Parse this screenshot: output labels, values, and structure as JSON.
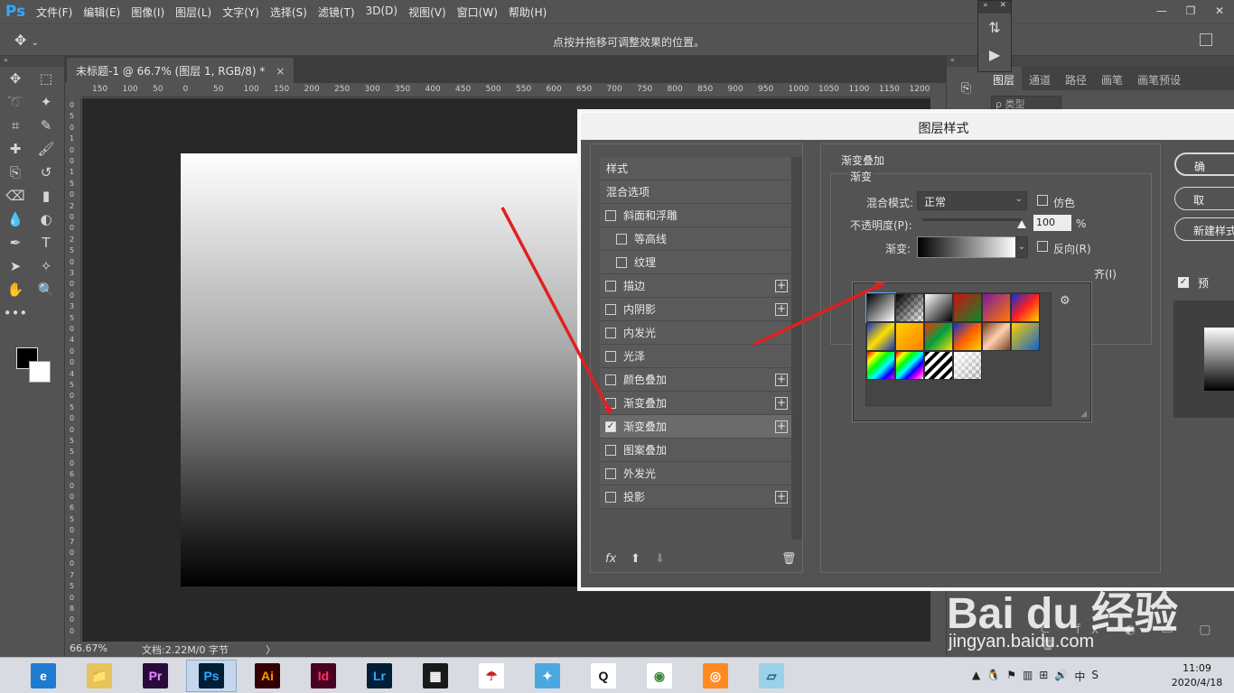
{
  "menubar": {
    "logo": "Ps",
    "items": [
      "文件(F)",
      "编辑(E)",
      "图像(I)",
      "图层(L)",
      "文字(Y)",
      "选择(S)",
      "滤镜(T)",
      "3D(D)",
      "视图(V)",
      "窗口(W)",
      "帮助(H)"
    ]
  },
  "options": {
    "hint": "点按并拖移可调整效果的位置。"
  },
  "document": {
    "tab_title": "未标题-1 @ 66.7% (图层 1, RGB/8) *",
    "close": "×",
    "ruler_h": [
      "150",
      "100",
      "50",
      "0",
      "50",
      "100",
      "150",
      "200",
      "250",
      "300",
      "350",
      "400",
      "450",
      "500",
      "550",
      "600",
      "650",
      "700",
      "750",
      "800",
      "850",
      "900",
      "950",
      "1000",
      "1050",
      "1100",
      "1150",
      "1200"
    ],
    "ruler_v": [
      "0",
      "5",
      "0",
      "1",
      "0",
      "0",
      "1",
      "5",
      "0",
      "2",
      "0",
      "0",
      "2",
      "5",
      "0",
      "3",
      "0",
      "0",
      "3",
      "5",
      "0",
      "4",
      "0",
      "0",
      "4",
      "5",
      "0",
      "5",
      "0",
      "0",
      "5",
      "5",
      "0",
      "6",
      "0",
      "0",
      "6",
      "5",
      "0",
      "7",
      "0",
      "0",
      "7",
      "5",
      "0",
      "8",
      "0",
      "0"
    ]
  },
  "status": {
    "zoom": "66.67%",
    "doc": "文档:2.22M/0 字节",
    "arrow": "〉"
  },
  "layers_panel": {
    "tabs": [
      "图层",
      "通道",
      "路径",
      "画笔",
      "画笔预设"
    ],
    "search": "ρ 类型"
  },
  "dialog": {
    "title": "图层样式",
    "styles_header": "样式",
    "blend_options": "混合选项",
    "styles": [
      {
        "label": "斜面和浮雕",
        "checked": false,
        "indent": false,
        "plus": false
      },
      {
        "label": "等高线",
        "checked": false,
        "indent": true,
        "plus": false
      },
      {
        "label": "纹理",
        "checked": false,
        "indent": true,
        "plus": false
      },
      {
        "label": "描边",
        "checked": false,
        "indent": false,
        "plus": true
      },
      {
        "label": "内阴影",
        "checked": false,
        "indent": false,
        "plus": true
      },
      {
        "label": "内发光",
        "checked": false,
        "indent": false,
        "plus": false
      },
      {
        "label": "光泽",
        "checked": false,
        "indent": false,
        "plus": false
      },
      {
        "label": "颜色叠加",
        "checked": false,
        "indent": false,
        "plus": true
      },
      {
        "label": "渐变叠加",
        "checked": false,
        "indent": false,
        "plus": true
      },
      {
        "label": "渐变叠加",
        "checked": true,
        "indent": false,
        "plus": true,
        "selected": true
      },
      {
        "label": "图案叠加",
        "checked": false,
        "indent": false,
        "plus": false
      },
      {
        "label": "外发光",
        "checked": false,
        "indent": false,
        "plus": false
      },
      {
        "label": "投影",
        "checked": false,
        "indent": false,
        "plus": true
      }
    ],
    "footer": {
      "fx": "fx",
      "up": "⬆",
      "down": "⬇",
      "trash": "🗑"
    },
    "section_title": "渐变叠加",
    "subsection": "渐变",
    "blend_mode_label": "混合模式:",
    "blend_mode_value": "正常",
    "dither_label": "仿色",
    "opacity_label": "不透明度(P):",
    "opacity_value": "100",
    "opacity_percent": 100,
    "percent_sign": "%",
    "gradient_label": "渐变:",
    "reverse_label": "反向(R)",
    "align_partial": "齐(I)",
    "ok_partial": "确",
    "cancel_partial": "取",
    "new_style_partial": "新建样式",
    "preview_partial": "预",
    "check_mark": "✓"
  },
  "picker": {
    "gear": "⚙",
    "swatches": [
      "linear-gradient(135deg,#000 0%,#fff 100%)",
      "linear-gradient(135deg,#000 0%,rgba(0,0,0,0) 100%)",
      "linear-gradient(135deg,#fff 0%,#000 100%)",
      "linear-gradient(135deg,#d01010 0%,#0a8a2a 100%)",
      "linear-gradient(135deg,#7a1aa0 0%,#ff7a00 100%)",
      "linear-gradient(135deg,#1030d0 0%,#ff2020 50%,#ffd000 100%)",
      "linear-gradient(135deg,#1030d0 0%,#ffe000 50%,#1030d0 100%)",
      "linear-gradient(135deg,#ffd000 0%,#ff8000 100%)",
      "linear-gradient(135deg,#ff3000 0%,#00a040 50%,#ffe000 100%)",
      "linear-gradient(135deg,#1030d0 0%,#ff6000 50%,#ffd000 100%)",
      "linear-gradient(135deg,#7a4020 0%,#ffd0b0 50%,#7a4020 100%)",
      "linear-gradient(135deg,#ffd000 0%,#1060d0 100%)",
      "linear-gradient(135deg,#ff0000,#ffff00,#00ff00,#00ffff,#0000ff,#ff00ff)",
      "linear-gradient(135deg,#ff0000,#ffff00,#00ff00,#00ffff,#0000ff,#ff00ff,rgba(255,255,255,0))",
      "repeating-linear-gradient(135deg,#000 0 4px,#fff 4px 8px)",
      "linear-gradient(135deg,rgba(255,255,255,0.9),rgba(0,0,0,0.1))"
    ]
  },
  "watermark": {
    "text": "Bai du 经验",
    "sub": "jingyan.baidu.com"
  },
  "taskbar": {
    "apps": [
      {
        "name": "ie",
        "label": "e",
        "bg": "#1e7bd0",
        "fg": "#ffffff"
      },
      {
        "name": "explorer",
        "label": "📁",
        "bg": "#e8c25a",
        "fg": "#6a4a10"
      },
      {
        "name": "premiere",
        "label": "Pr",
        "bg": "#2a0a3a",
        "fg": "#e88cff"
      },
      {
        "name": "photoshop",
        "label": "Ps",
        "bg": "#001e36",
        "fg": "#31a8ff"
      },
      {
        "name": "illustrator",
        "label": "Ai",
        "bg": "#330000",
        "fg": "#ff9a00"
      },
      {
        "name": "indesign",
        "label": "Id",
        "bg": "#49021f",
        "fg": "#ff3366"
      },
      {
        "name": "lightroom",
        "label": "Lr",
        "bg": "#001e36",
        "fg": "#31a8ff"
      },
      {
        "name": "media",
        "label": "▦",
        "bg": "#1a1a1a",
        "fg": "#ffffff"
      },
      {
        "name": "umbrella",
        "label": "☂",
        "bg": "#ffffff",
        "fg": "#d02020"
      },
      {
        "name": "bird",
        "label": "✦",
        "bg": "#4aa8e0",
        "fg": "#ffffff"
      },
      {
        "name": "qq",
        "label": "Q",
        "bg": "#ffffff",
        "fg": "#111111"
      },
      {
        "name": "chrome",
        "label": "◉",
        "bg": "#ffffff",
        "fg": "#3a8a3a"
      },
      {
        "name": "firefox",
        "label": "◎",
        "bg": "#ff8a20",
        "fg": "#ffffff"
      },
      {
        "name": "notes",
        "label": "▱",
        "bg": "#9ad0e8",
        "fg": "#1a5a80"
      }
    ],
    "tray": [
      "▲",
      "🐧",
      "⚑",
      "▥",
      "⊞",
      "🔊",
      "中",
      "S"
    ],
    "time": "11:09",
    "date": "2020/4/18"
  },
  "colors": {
    "accent": "#31a8ff",
    "arrow": "#e02020"
  }
}
